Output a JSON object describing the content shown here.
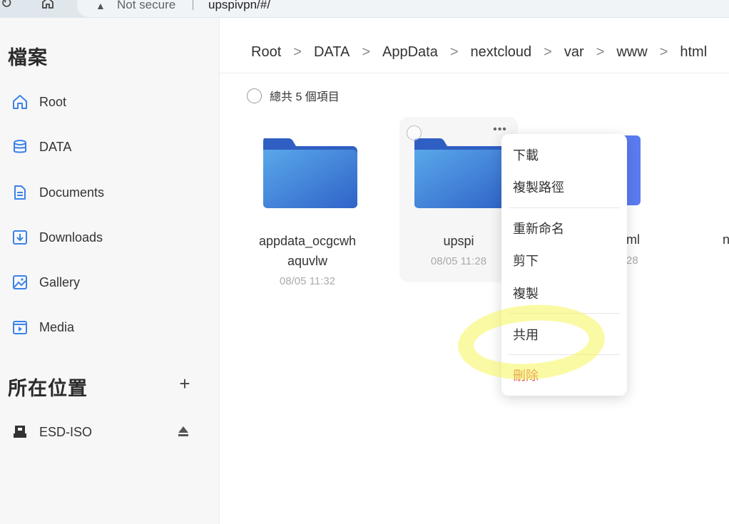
{
  "browser": {
    "back_icon": "reload-icon",
    "home_icon": "home-icon",
    "security_label": "Not secure",
    "url": "upspivpn/#/"
  },
  "sidebar": {
    "title": "檔案",
    "items": [
      {
        "label": "Root",
        "icon": "home-icon"
      },
      {
        "label": "DATA",
        "icon": "database-icon"
      },
      {
        "label": "Documents",
        "icon": "document-icon"
      },
      {
        "label": "Downloads",
        "icon": "download-icon"
      },
      {
        "label": "Gallery",
        "icon": "image-icon"
      },
      {
        "label": "Media",
        "icon": "video-icon"
      }
    ],
    "locations_title": "所在位置",
    "locations": [
      {
        "label": "ESD-ISO",
        "icon": "usb-drive-icon"
      }
    ],
    "accent_color": "#3b82e8"
  },
  "breadcrumb": [
    "Root",
    "DATA",
    "AppData",
    "nextcloud",
    "var",
    "www",
    "html"
  ],
  "selection": {
    "count_label": "總共 5 個項目"
  },
  "files": [
    {
      "name_line1": "appdata_ocgcwh",
      "name_line2": "aquvlw",
      "date": "08/05 11:32"
    },
    {
      "name_line1": "upspi",
      "name_line2": "",
      "date": "08/05 11:28"
    }
  ],
  "partial_files": [
    {
      "name_fragment": "ml",
      "date_fragment": "28"
    },
    {
      "name_fragment": "n"
    }
  ],
  "context_menu": {
    "items": [
      "下載",
      "複製路徑",
      "重新命名",
      "剪下",
      "複製",
      "共用",
      "刪除"
    ]
  }
}
